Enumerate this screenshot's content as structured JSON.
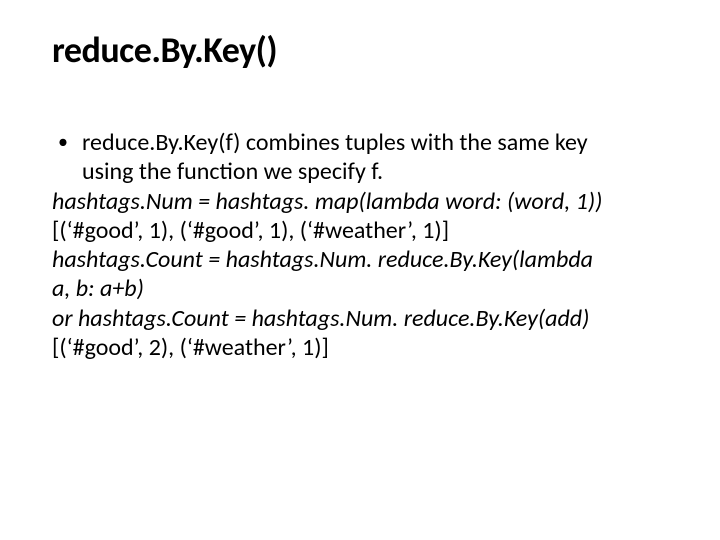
{
  "title": "reduce.By.Key()",
  "bullet": {
    "mark": "•",
    "line1": "reduce.By.Key(f) combines tuples with the same key",
    "line2": "using the function we specify f."
  },
  "code": {
    "l1": "hashtags.Num = hashtags. map(lambda word: (word, 1))",
    "l2": "[(‘#good’, 1), (‘#good’, 1), (‘#weather’, 1)]",
    "l3": "hashtags.Count = hashtags.Num. reduce.By.Key(lambda",
    "l4": "a, b: a+b)",
    "l5": "or hashtags.Count = hashtags.Num. reduce.By.Key(add)",
    "l6": "[(‘#good’, 2), (‘#weather’, 1)]"
  }
}
